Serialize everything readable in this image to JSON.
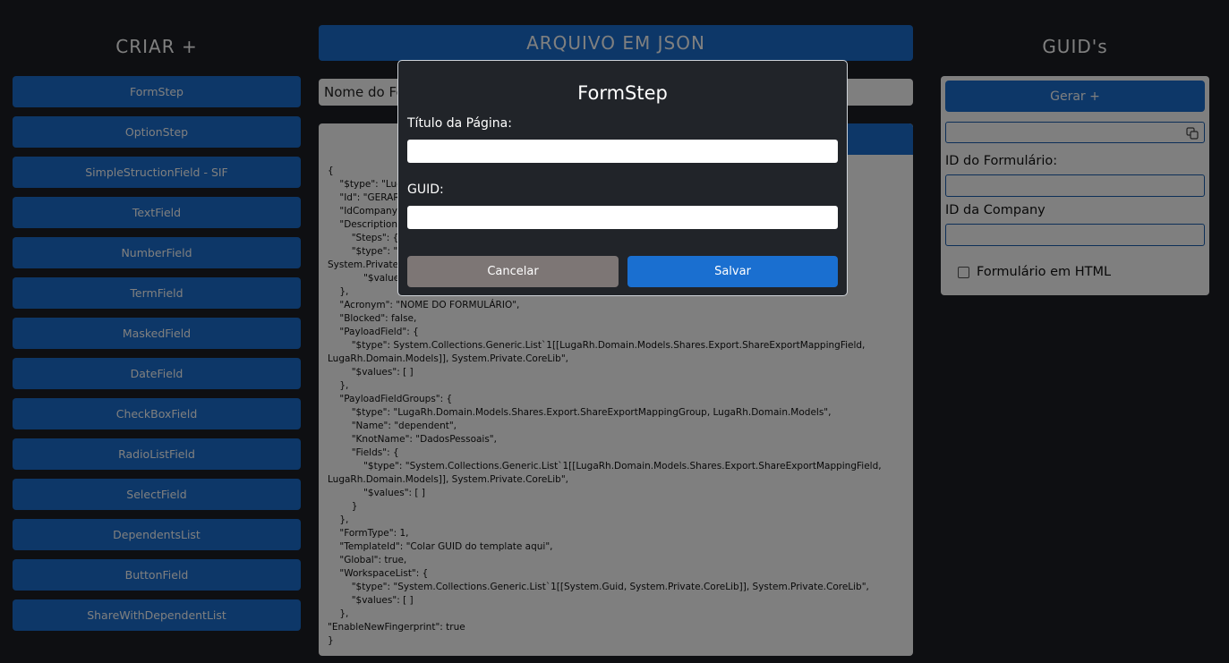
{
  "left": {
    "title": "CRIAR +",
    "buttons": [
      "FormStep",
      "OptionStep",
      "SimpleStructionField - SIF",
      "TextField",
      "NumberField",
      "TermField",
      "MaskedField",
      "DateField",
      "CheckBoxField",
      "RadioListField",
      "SelectField",
      "DependentsList",
      "ButtonField",
      "ShareWithDependentList"
    ]
  },
  "middle": {
    "banner": "ARQUIVO EM JSON",
    "form_name_value": "Nome do Fo",
    "json_lines": [
      "{",
      "    \"$type\": \"Lug",
      "    \"Id\": \"GERAR",
      "    \"IdCompany\"",
      "    \"Description\"",
      "        \"Steps\": {",
      "        \"$type\": \"S",
      "System.Private",
      "            \"$values",
      "    },",
      "    \"Acronym\": \"NOME DO FORMULÁRIO\",",
      "    \"Blocked\": false,",
      "    \"PayloadField\": {",
      "        \"$type\": System.Collections.Generic.List`1[[LugaRh.Domain.Models.Shares.Export.ShareExportMappingField,",
      "LugaRh.Domain.Models]], System.Private.CoreLib\",",
      "        \"$values\": [ ]",
      "    },",
      "    \"PayloadFieldGroups\": {",
      "        \"$type\": \"LugaRh.Domain.Models.Shares.Export.ShareExportMappingGroup, LugaRh.Domain.Models\",",
      "        \"Name\": \"dependent\",",
      "        \"KnotName\": \"DadosPessoais\",",
      "        \"Fields\": {",
      "            \"$type\": \"System.Collections.Generic.List`1[[LugaRh.Domain.Models.Shares.Export.ShareExportMappingField,",
      "LugaRh.Domain.Models]], System.Private.CoreLib\",",
      "            \"$values\": [ ]",
      "        }",
      "    },",
      "    \"FormType\": 1,",
      "    \"TemplateId\": \"Colar GUID do template aqui\",",
      "    \"Global\": true,",
      "    \"WorkspaceList\": {",
      "        \"$type\": \"System.Collections.Generic.List`1[[System.Guid, System.Private.CoreLib]], System.Private.CoreLib\",",
      "        \"$values\": [ ]",
      "    },",
      "\"EnableNewFingerprint\": true",
      "}"
    ]
  },
  "right": {
    "title": "GUID's",
    "generate_button": "Gerar +",
    "form_id_label": "ID do Formulário:",
    "company_id_label": "ID da Company",
    "html_checkbox_label": "Formulário em HTML"
  },
  "modal": {
    "title": "FormStep",
    "page_title_label": "Título da Página:",
    "guid_label": "GUID:",
    "cancel_button": "Cancelar",
    "save_button": "Salvar"
  }
}
